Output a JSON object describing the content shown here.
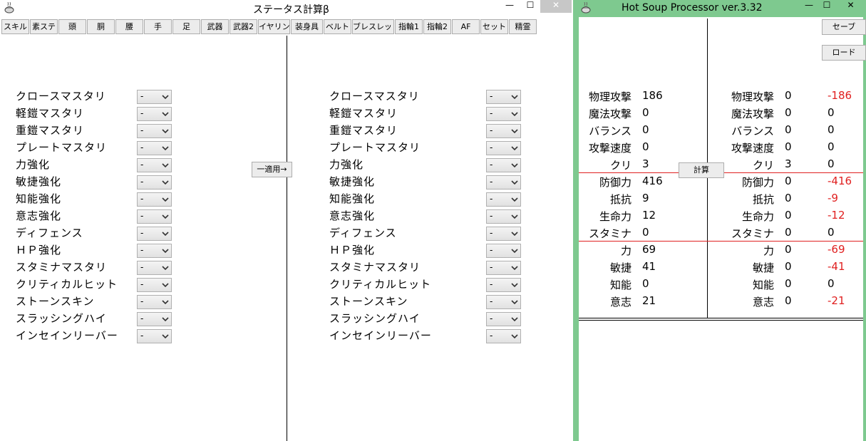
{
  "window1": {
    "title": "ステータス計算β",
    "min_glyph": "—",
    "max_glyph": "☐",
    "close_glyph": "✕",
    "tabs": [
      "スキル",
      "素ステ",
      "頭",
      "胴",
      "腰",
      "手",
      "足",
      "武器",
      "武器2",
      "イヤリング",
      "装身具",
      "ベルト",
      "ブレスレット",
      "指輪1",
      "指輪2",
      "AF",
      "セット",
      "精霊"
    ],
    "apply_label": "一適用→",
    "left_panel": {
      "skills": [
        "クロースマスタリ",
        "軽鎧マスタリ",
        "重鎧マスタリ",
        "プレートマスタリ",
        "力強化",
        "敏捷強化",
        "知能強化",
        "意志強化",
        "ディフェンス",
        "ＨＰ強化",
        "スタミナマスタリ",
        "クリティカルヒット",
        "ストーンスキン",
        "スラッシングハイ",
        "インセインリーバー"
      ],
      "values": [
        "-",
        "-",
        "-",
        "-",
        "-",
        "-",
        "-",
        "-",
        "-",
        "-",
        "-",
        "-",
        "-",
        "-",
        "-"
      ]
    },
    "right_panel": {
      "skills": [
        "クロースマスタリ",
        "軽鎧マスタリ",
        "重鎧マスタリ",
        "プレートマスタリ",
        "力強化",
        "敏捷強化",
        "知能強化",
        "意志強化",
        "ディフェンス",
        "ＨＰ強化",
        "スタミナマスタリ",
        "クリティカルヒット",
        "ストーンスキン",
        "スラッシングハイ",
        "インセインリーバー"
      ],
      "values": [
        "-",
        "-",
        "-",
        "-",
        "-",
        "-",
        "-",
        "-",
        "-",
        "-",
        "-",
        "-",
        "-",
        "-",
        "-"
      ]
    }
  },
  "window2": {
    "title": "Hot Soup Processor ver.3.32",
    "min_glyph": "—",
    "max_glyph": "☐",
    "close_glyph": "✕",
    "save_label": "セーブ",
    "load_label": "ロード",
    "calc_label": "計算",
    "stat_names": [
      "物理攻撃",
      "魔法攻撃",
      "バランス",
      "攻撃速度",
      "クリ",
      "防御力",
      "抵抗",
      "生命力",
      "スタミナ",
      "力",
      "敏捷",
      "知能",
      "意志"
    ],
    "left_values": [
      "186",
      "0",
      "0",
      "0",
      "3",
      "416",
      "9",
      "12",
      "0",
      "69",
      "41",
      "0",
      "21"
    ],
    "right_values": [
      "0",
      "0",
      "0",
      "0",
      "3",
      "0",
      "0",
      "0",
      "0",
      "0",
      "0",
      "0",
      "0"
    ],
    "diff_values": [
      "-186",
      "0",
      "0",
      "0",
      "0",
      "-416",
      "-9",
      "-12",
      "0",
      "-69",
      "-41",
      "0",
      "-21"
    ],
    "colors": {
      "frame": "#7ec98f",
      "negative": "#e02020",
      "divider": "#e02020"
    }
  }
}
